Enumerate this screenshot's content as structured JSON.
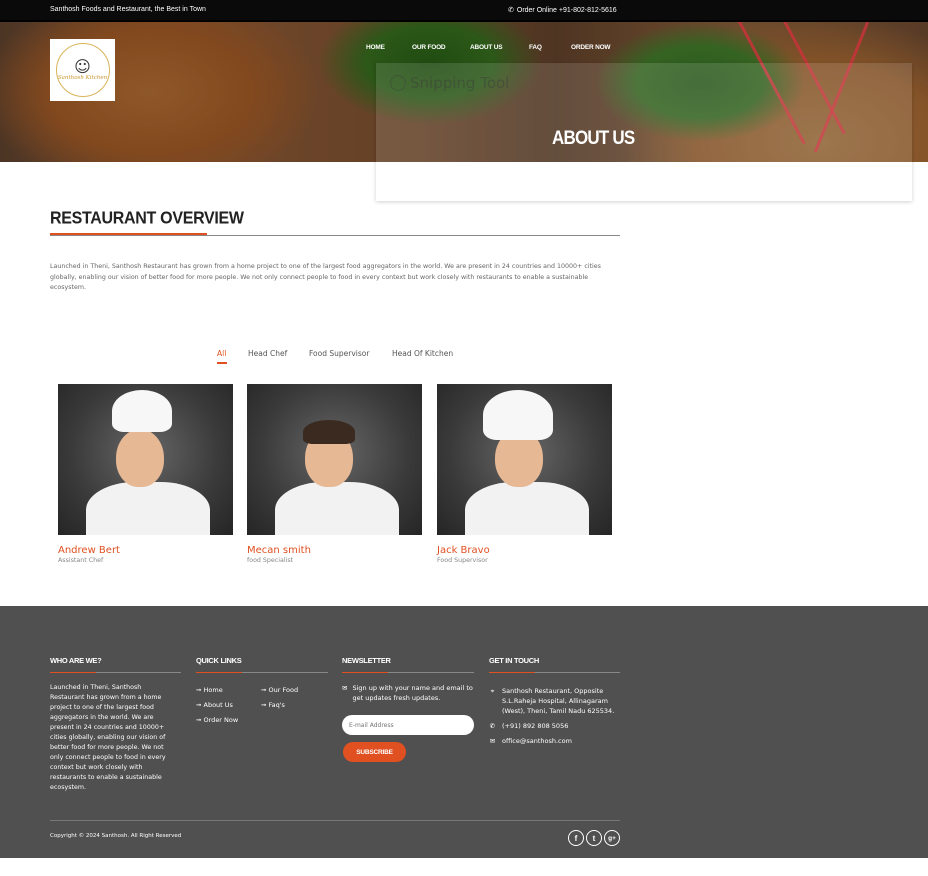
{
  "topbar": {
    "tagline": "Santhosh Foods and Restaurant, the Best in Town",
    "order_label": "Order Online +91-802-812-5616"
  },
  "logo": {
    "script_text": "Santhosh Kitchen"
  },
  "nav": {
    "items": [
      {
        "label": "HOME"
      },
      {
        "label": "OUR FOOD"
      },
      {
        "label": "ABOUT US"
      },
      {
        "label": "FAQ"
      },
      {
        "label": "ORDER NOW"
      }
    ]
  },
  "overlay": {
    "snipping_text": "Snipping Tool"
  },
  "hero": {
    "title": "ABOUT US"
  },
  "overview": {
    "title": "RESTAURANT OVERVIEW",
    "text": "Launched in Theni, Santhosh Restaurant has grown from a home project to one of the largest food aggregators in the world. We are present in 24 countries and 10000+ cities globally, enabling our vision of better food for more people. We not only connect people to food in every context but work closely with restaurants to enable a sustainable ecosystem."
  },
  "filters": {
    "items": [
      {
        "label": "All",
        "active": true
      },
      {
        "label": "Head Chef"
      },
      {
        "label": "Food Supervisor"
      },
      {
        "label": "Head Of Kitchen"
      }
    ]
  },
  "team": [
    {
      "name": "Andrew Bert",
      "role": "Assistant Chef"
    },
    {
      "name": "Mecan smith",
      "role": "food Specialist"
    },
    {
      "name": "Jack Bravo",
      "role": "Food Supervisor"
    }
  ],
  "footer": {
    "who": {
      "title": "WHO ARE WE?",
      "text": "Launched in Theni, Santhosh Restaurant has grown from a home project to one of the largest food aggregators in the world. We are present in 24 countries and 10000+ cities globally, enabling our vision of better food for more people. We not only connect people to food in every context but work closely with restaurants to enable a sustainable ecosystem."
    },
    "quick": {
      "title": "QUICK LINKS",
      "links": [
        {
          "label": "➞ Home"
        },
        {
          "label": "➞ Our Food"
        },
        {
          "label": "➞ About Us"
        },
        {
          "label": "➞ Faq's"
        },
        {
          "label": "➞ Order Now"
        }
      ]
    },
    "newsletter": {
      "title": "NEWSLETTER",
      "text": "Sign up with your name and email to get updates fresh updates.",
      "email_placeholder": "E-mail Address",
      "subscribe_label": "SUBSCRIBE"
    },
    "contact": {
      "title": "GET IN TOUCH",
      "address": "Santhosh Restaurant, Opposite S.L.Raheja Hospital, Allinagaram (West), Theni, Tamil Nadu 625534.",
      "phone": "(+91) 892 808 5056",
      "email": "office@santhosh.com"
    },
    "copyright": "Copyright © 2024 Santhosh. All Right Reserved",
    "social": [
      {
        "icon": "facebook-icon",
        "glyph": "f"
      },
      {
        "icon": "twitter-icon",
        "glyph": "t"
      },
      {
        "icon": "googleplus-icon",
        "glyph": "g+"
      }
    ]
  },
  "colors": {
    "accent": "#e05020",
    "footer_bg": "#505050",
    "topbar_bg": "#0a0a0a"
  }
}
